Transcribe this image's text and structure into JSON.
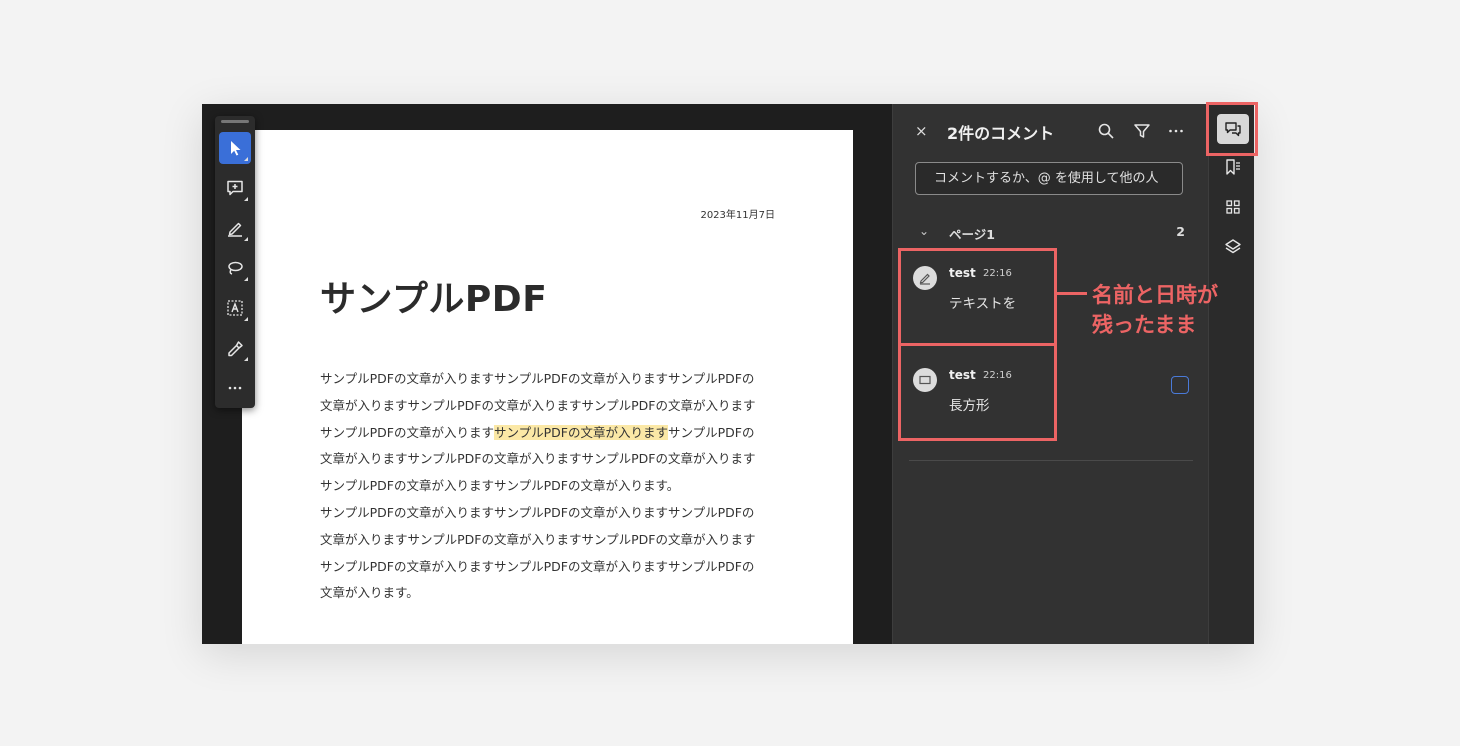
{
  "document": {
    "date": "2023年11月7日",
    "title": "サンプルPDF",
    "body_lines": [
      "サンプルPDFの文章が入りますサンプルPDFの文章が入りますサンプルPDFの",
      "文章が入りますサンプルPDFの文章が入りますサンプルPDFの文章が入ります",
      "サンプルPDFの文章が入ります",
      "サンプルPDFの文章が入りますサンプルPDFの文章が入りますサンプルPDFの文章が入ります",
      "サンプルPDFの文章が入りますサンプルPDFの文章が入ります。",
      "サンプルPDFの文章が入りますサンプルPDFの文章が入りますサンプルPDFの",
      "文章が入りますサンプルPDFの文章が入りますサンプルPDFの文章が入ります",
      "サンプルPDFの文章が入りますサンプルPDFの文章が入りますサンプルPDFの",
      "文章が入ります。"
    ],
    "line3_highlight": "サンプルPDFの文章が入ります",
    "line3_after": "サンプルPDFの",
    "line4": "文章が入りますサンプルPDFの文章が入りますサンプルPDFの文章が入ります"
  },
  "toolbar": {
    "tools": [
      "select-icon",
      "add-comment-icon",
      "highlight-pen-icon",
      "lasso-icon",
      "text-box-icon",
      "sign-icon",
      "more-icon"
    ]
  },
  "comments_panel": {
    "close_label": "×",
    "title": "2件のコメント",
    "input_placeholder": "コメントするか、@ を使用して他の人",
    "page_group_label": "ページ1",
    "page_group_count": "2",
    "comments": [
      {
        "author": "test",
        "time": "22:16",
        "text": "テキストを",
        "type_icon": "highlighter-icon"
      },
      {
        "author": "test",
        "time": "22:16",
        "text": "長方形",
        "type_icon": "rectangle-icon"
      }
    ]
  },
  "annotation": {
    "line1": "名前と日時が",
    "line2": "残ったまま",
    "color": "#ec6464"
  },
  "colors": {
    "accent": "#3a6fd8",
    "highlight": "#fbe8a6",
    "panel_bg": "#323232"
  }
}
